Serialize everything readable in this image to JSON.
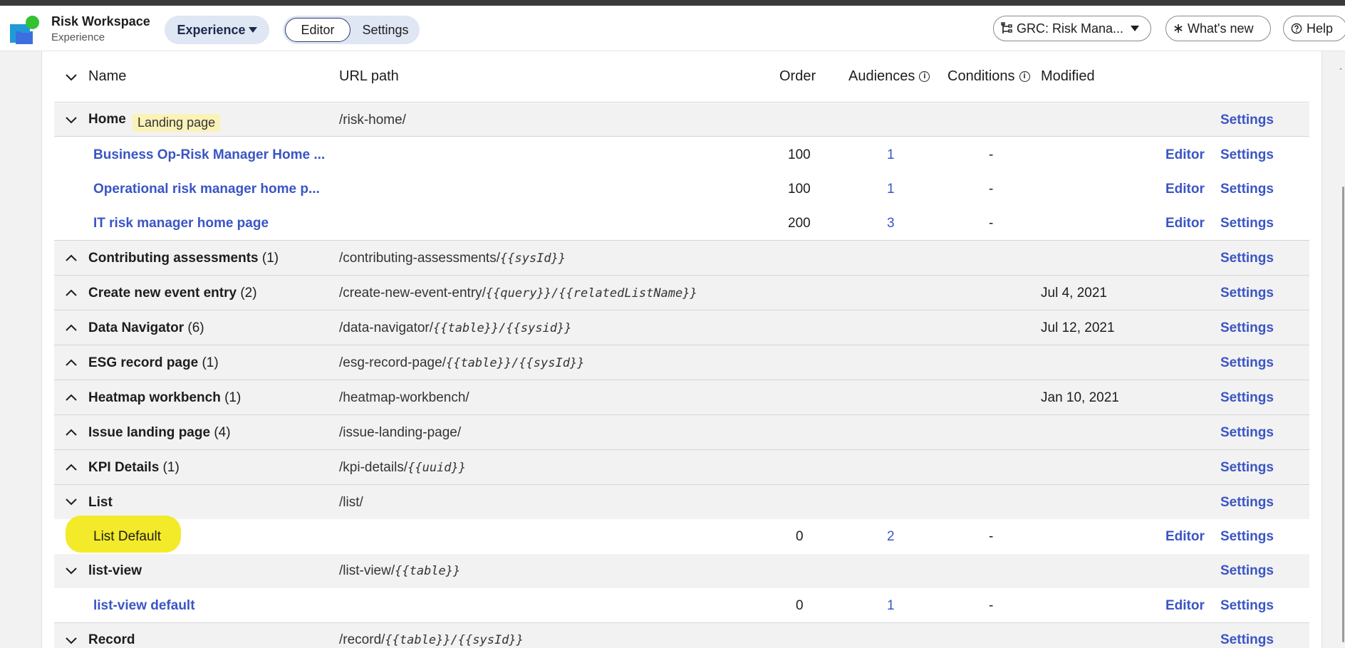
{
  "header": {
    "app_title": "Risk Workspace",
    "app_subtitle": "Experience",
    "experience_menu": "Experience",
    "segment": {
      "editor": "Editor",
      "settings": "Settings"
    },
    "scope_selector": "GRC: Risk Mana...",
    "whats_new": "What's new",
    "help": "Help"
  },
  "table": {
    "columns": {
      "name": "Name",
      "url_path": "URL path",
      "order": "Order",
      "audiences": "Audiences",
      "conditions": "Conditions",
      "modified": "Modified"
    },
    "rows": [
      {
        "name": "Home",
        "count": "",
        "tag": "Landing page",
        "path": "/risk-home/",
        "path_vars": "",
        "modified": "",
        "settings": "Settings",
        "expanded": true
      },
      {
        "name": "Business Op-Risk Manager Home ...",
        "order": "100",
        "audiences": "1",
        "conditions": "-",
        "editor": "Editor",
        "settings": "Settings"
      },
      {
        "name": "Operational risk manager home p...",
        "order": "100",
        "audiences": "1",
        "conditions": "-",
        "editor": "Editor",
        "settings": "Settings"
      },
      {
        "name": "IT risk manager home page",
        "order": "200",
        "audiences": "3",
        "conditions": "-",
        "editor": "Editor",
        "settings": "Settings"
      },
      {
        "name": "Contributing assessments",
        "count": "(1)",
        "path": "/contributing-assessments/",
        "path_vars": "{{sysId}}",
        "modified": "",
        "settings": "Settings",
        "expanded": false
      },
      {
        "name": "Create new event entry",
        "count": "(2)",
        "path": "/create-new-event-entry/",
        "path_vars": "{{query}}/{{relatedListName}}",
        "modified": "Jul 4, 2021",
        "settings": "Settings",
        "expanded": false
      },
      {
        "name": "Data Navigator",
        "count": "(6)",
        "path": "/data-navigator/",
        "path_vars": "{{table}}/{{sysid}}",
        "modified": "Jul 12, 2021",
        "settings": "Settings",
        "expanded": false
      },
      {
        "name": "ESG record page",
        "count": "(1)",
        "path": "/esg-record-page/",
        "path_vars": "{{table}}/{{sysId}}",
        "modified": "",
        "settings": "Settings",
        "expanded": false
      },
      {
        "name": "Heatmap workbench",
        "count": "(1)",
        "path": "/heatmap-workbench/",
        "path_vars": "",
        "modified": "Jan 10, 2021",
        "settings": "Settings",
        "expanded": false
      },
      {
        "name": "Issue landing page",
        "count": "(4)",
        "path": "/issue-landing-page/",
        "path_vars": "",
        "modified": "",
        "settings": "Settings",
        "expanded": false
      },
      {
        "name": "KPI Details",
        "count": "(1)",
        "path": "/kpi-details/",
        "path_vars": "{{uuid}}",
        "modified": "",
        "settings": "Settings",
        "expanded": false
      },
      {
        "name": "List",
        "count": "",
        "path": "/list/",
        "path_vars": "",
        "modified": "",
        "settings": "Settings",
        "expanded": true
      },
      {
        "name": "List Default",
        "order": "0",
        "audiences": "2",
        "conditions": "-",
        "editor": "Editor",
        "settings": "Settings"
      },
      {
        "name": "list-view",
        "count": "",
        "path": "/list-view/",
        "path_vars": "{{table}}",
        "modified": "",
        "settings": "Settings",
        "expanded": true
      },
      {
        "name": "list-view default",
        "order": "0",
        "audiences": "1",
        "conditions": "-",
        "editor": "Editor",
        "settings": "Settings"
      },
      {
        "name": "Record",
        "count": "",
        "path": "/record/",
        "path_vars": "{{table}}/{{sysId}}",
        "modified": "",
        "settings": "Settings",
        "expanded": true
      }
    ]
  },
  "colors": {
    "link": "#3a55c5",
    "group_row_bg": "#f2f2f2",
    "tag_bg": "#fbf2b8",
    "highlight": "#f3ea2a"
  },
  "icons": [
    "chevron-down-icon",
    "chevron-up-icon",
    "info-icon",
    "hierarchy-icon",
    "asterisk-icon",
    "help-icon"
  ]
}
